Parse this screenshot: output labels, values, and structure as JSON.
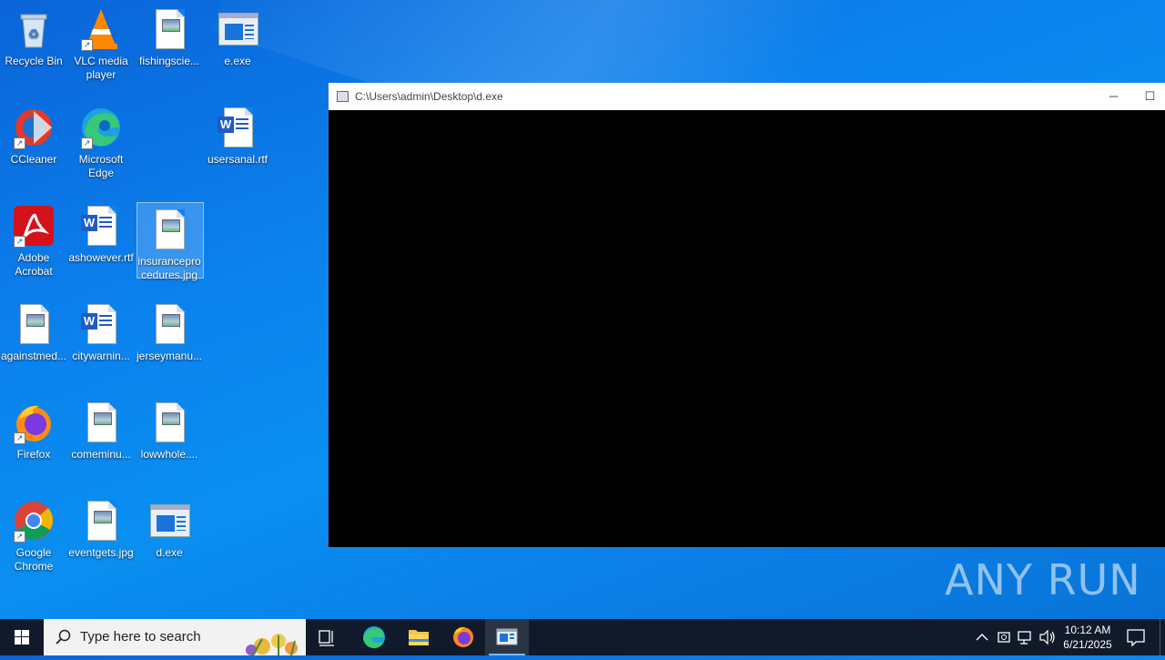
{
  "desktop": {
    "icons": [
      {
        "label": "Recycle Bin"
      },
      {
        "label": "VLC media player"
      },
      {
        "label": "fishingscie..."
      },
      {
        "label": "e.exe"
      },
      {
        "label": "CCleaner"
      },
      {
        "label": "Microsoft Edge"
      },
      {
        "label": "usersanal.rtf"
      },
      {
        "label": "Adobe Acrobat"
      },
      {
        "label": "ashowever.rtf"
      },
      {
        "label": "insuranceprocedures.jpg"
      },
      {
        "label": "againstmed..."
      },
      {
        "label": "citywarnin..."
      },
      {
        "label": "jerseymanu..."
      },
      {
        "label": "Firefox"
      },
      {
        "label": "comeminu..."
      },
      {
        "label": "lowwhole...."
      },
      {
        "label": "Google Chrome"
      },
      {
        "label": "eventgets.jpg"
      },
      {
        "label": "d.exe"
      }
    ]
  },
  "console_window": {
    "title": "C:\\Users\\admin\\Desktop\\d.exe",
    "minimize_glyph": "─",
    "maximize_glyph": "☐"
  },
  "watermark": {
    "text": "ANY RUN"
  },
  "taskbar": {
    "search_placeholder": "Type here to search",
    "clock_time": "10:12 AM",
    "clock_date": "6/21/2025"
  },
  "colors": {
    "accent": "#0b83ee",
    "taskbar": "#101a2a"
  }
}
